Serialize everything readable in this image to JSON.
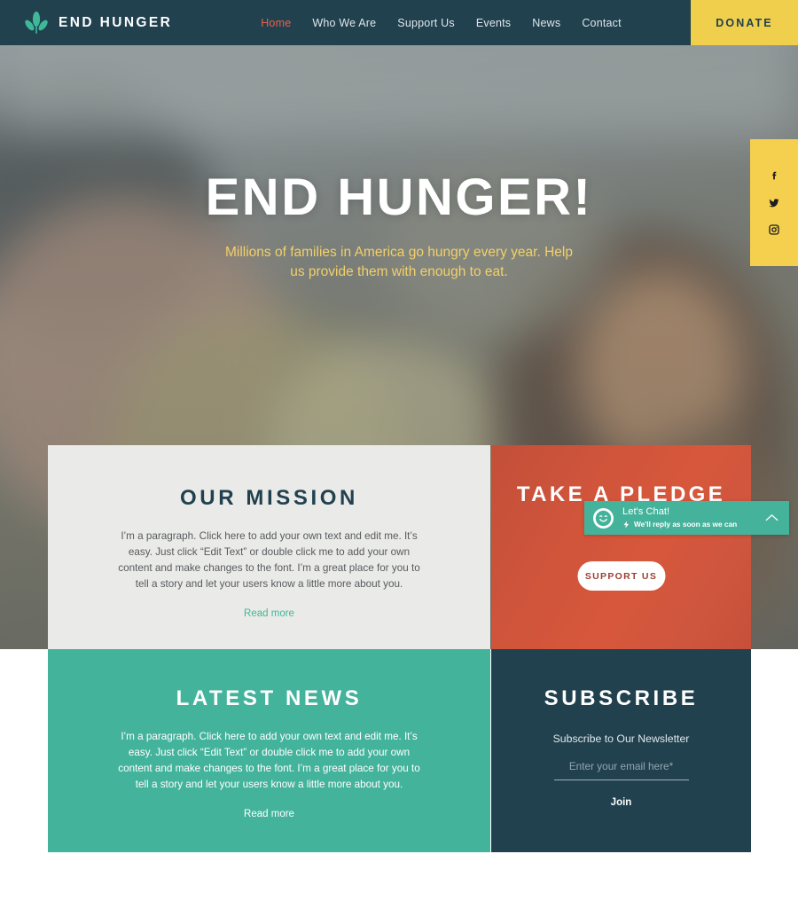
{
  "header": {
    "brand": "END HUNGER",
    "logo_icon": "leaf-icon",
    "nav": [
      {
        "label": "Home",
        "active": true
      },
      {
        "label": "Who We Are",
        "active": false
      },
      {
        "label": "Support Us",
        "active": false
      },
      {
        "label": "Events",
        "active": false
      },
      {
        "label": "News",
        "active": false
      },
      {
        "label": "Contact",
        "active": false
      }
    ],
    "donate_label": "DONATE",
    "bg_color": "#21414f",
    "donate_bg": "#f0cf4d",
    "active_color": "#e8614c"
  },
  "hero": {
    "title": "END HUNGER!",
    "subtitle": "Millions of families in America go hungry every year. Help us provide them with enough to eat.",
    "title_color": "#ffffff",
    "subtitle_color": "#f2d06a"
  },
  "social": {
    "bg_color": "#f5d04f",
    "items": [
      {
        "icon": "facebook-icon",
        "label": "Facebook"
      },
      {
        "icon": "twitter-icon",
        "label": "Twitter"
      },
      {
        "icon": "instagram-icon",
        "label": "Instagram"
      }
    ]
  },
  "sections": {
    "mission": {
      "title": "OUR MISSION",
      "paragraph": "I’m a paragraph. Click here to add your own text and edit me. It’s easy. Just click “Edit Text” or double click me to add your own content and make changes to the font. I’m a great place for you to tell a story and let your users know a little more about you.",
      "read_more": "Read more",
      "bg_color": "#eaeae8",
      "title_color": "#21414f",
      "link_color": "#3fb89a"
    },
    "pledge": {
      "title": "TAKE A PLEDGE",
      "button_label": "SUPPORT US",
      "bg_color": "#d0543f"
    },
    "news": {
      "title": "LATEST NEWS",
      "paragraph": "I’m a paragraph. Click here to add your own text and edit me. It’s easy. Just click “Edit Text” or double click me to add your own content and make changes to the font. I’m a great place for you to tell a story and let your users know a little more about you.",
      "read_more": "Read more",
      "bg_color": "#44b39c"
    },
    "subscribe": {
      "title": "SUBSCRIBE",
      "label": "Subscribe to Our Newsletter",
      "email_value": "",
      "email_placeholder": "Enter your email here*",
      "join_label": "Join",
      "bg_color": "#21414f"
    }
  },
  "chat_widget": {
    "title": "Let's Chat!",
    "subtitle": "We'll reply as soon as we can",
    "avatar_icon": "smiley-icon",
    "bolt_icon": "lightning-bolt-icon",
    "collapse_icon": "chevron-up-icon",
    "bg_color": "#45b39b"
  }
}
